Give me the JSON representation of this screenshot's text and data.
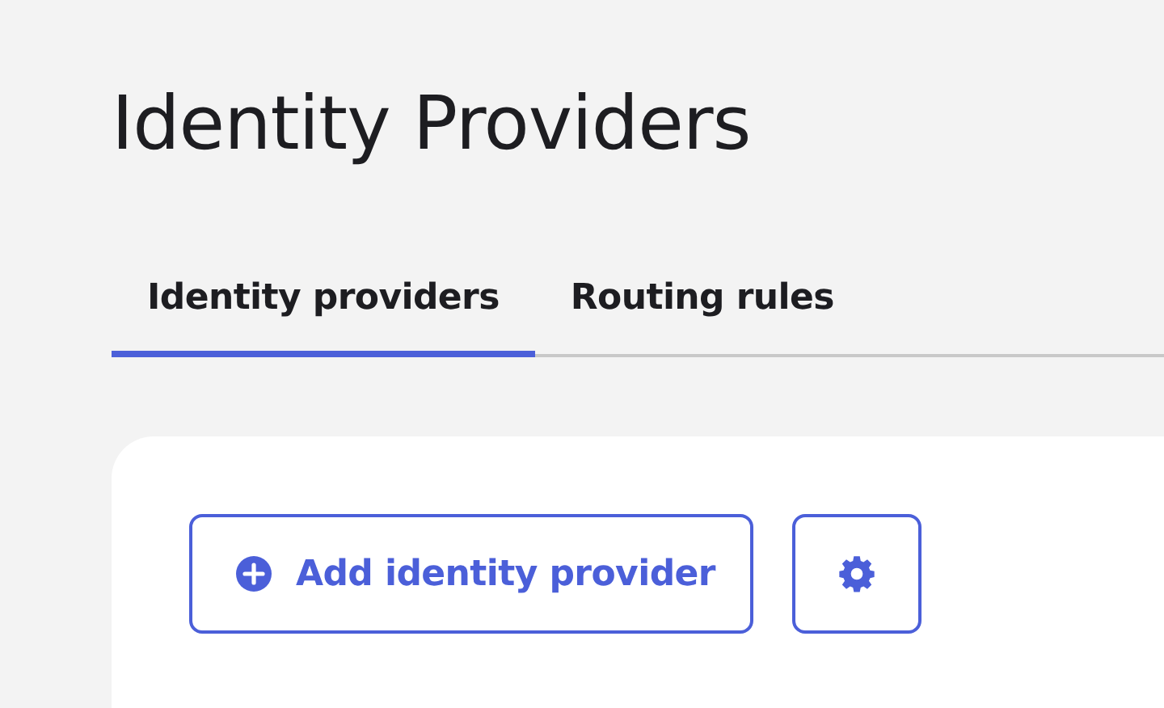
{
  "page": {
    "title": "Identity Providers"
  },
  "tabs": [
    {
      "label": "Identity providers",
      "selected": true
    },
    {
      "label": "Routing rules",
      "selected": false
    }
  ],
  "toolbar": {
    "add_button": "Add identity provider"
  }
}
